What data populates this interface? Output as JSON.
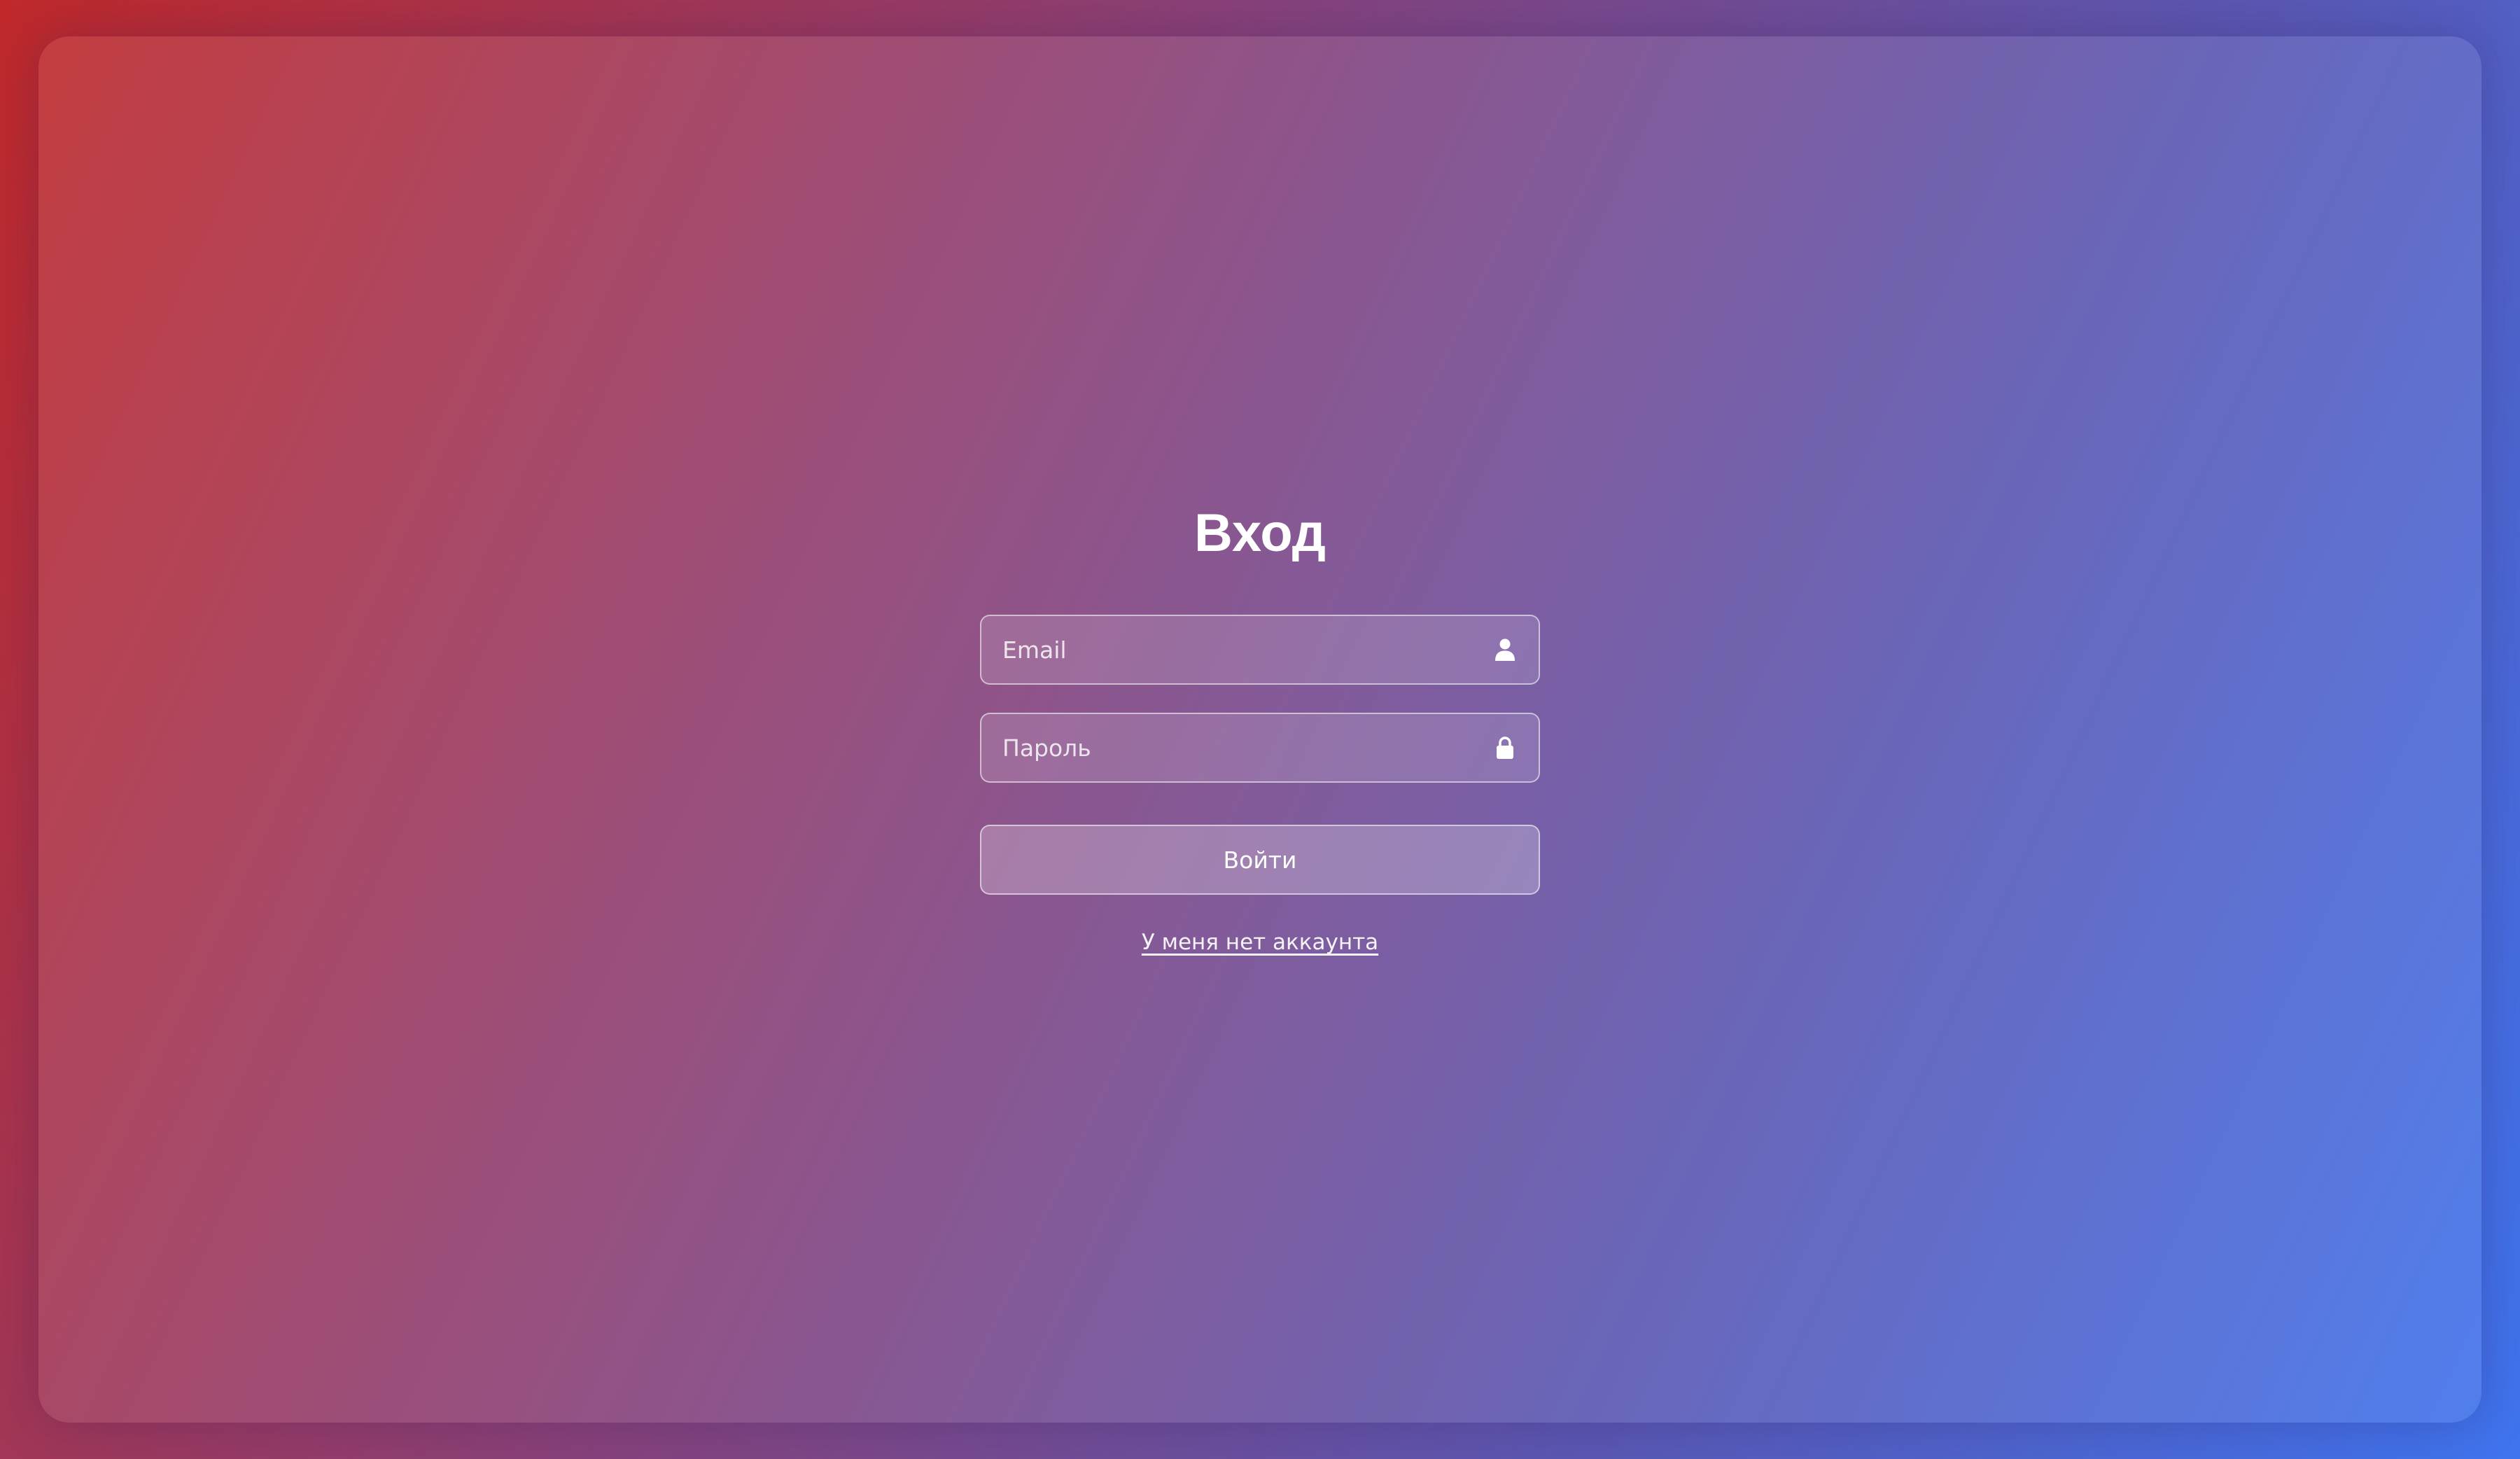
{
  "login_form": {
    "title": "Вход",
    "email": {
      "placeholder": "Email",
      "value": "",
      "icon": "user-icon"
    },
    "password": {
      "placeholder": "Пароль",
      "value": "",
      "icon": "lock-icon"
    },
    "submit_label": "Войти",
    "register_link": "У меня нет аккаунта"
  },
  "colors": {
    "gradient_start": "#c0292a",
    "gradient_middle": "#8e3f72",
    "gradient_end": "#3f74ef",
    "text": "#ffffff"
  }
}
